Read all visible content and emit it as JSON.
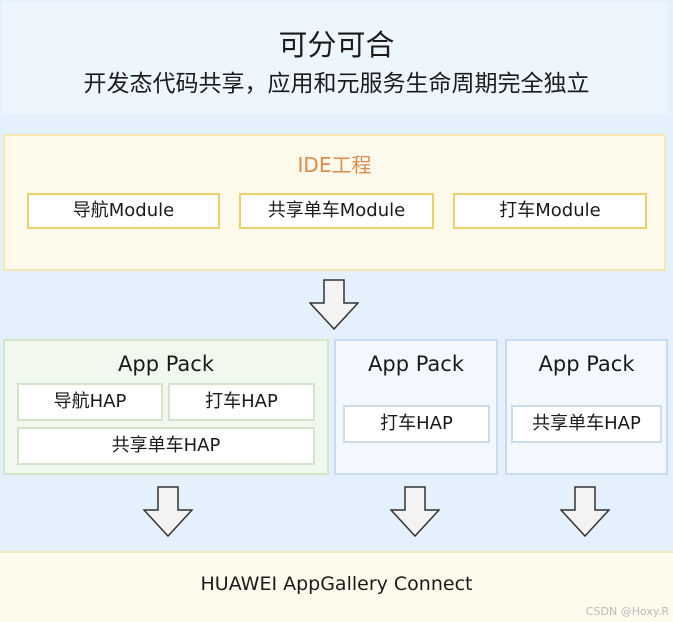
{
  "header": {
    "title": "可分可合",
    "subtitle": "开发态代码共享，应用和元服务生命周期完全独立"
  },
  "ide": {
    "title": "IDE工程",
    "modules": [
      "导航Module",
      "共享单车Module",
      "打车Module"
    ]
  },
  "packs": [
    {
      "title": "App Pack",
      "haps": [
        "导航HAP",
        "打车HAP",
        "共享单车HAP"
      ]
    },
    {
      "title": "App Pack",
      "haps": [
        "打车HAP"
      ]
    },
    {
      "title": "App Pack",
      "haps": [
        "共享单车HAP"
      ]
    }
  ],
  "footer": {
    "label": "HUAWEI AppGallery Connect"
  },
  "watermark": "CSDN @Hoxy.R",
  "colors": {
    "ide_title": "#de8a4c",
    "ide_bg": "#fefaeb",
    "module_border": "#ecd06a",
    "page_bg": "#e4f0fb",
    "green_pack_bg": "#f1f9ee",
    "blue_pack_bg": "#f2f8fd"
  }
}
